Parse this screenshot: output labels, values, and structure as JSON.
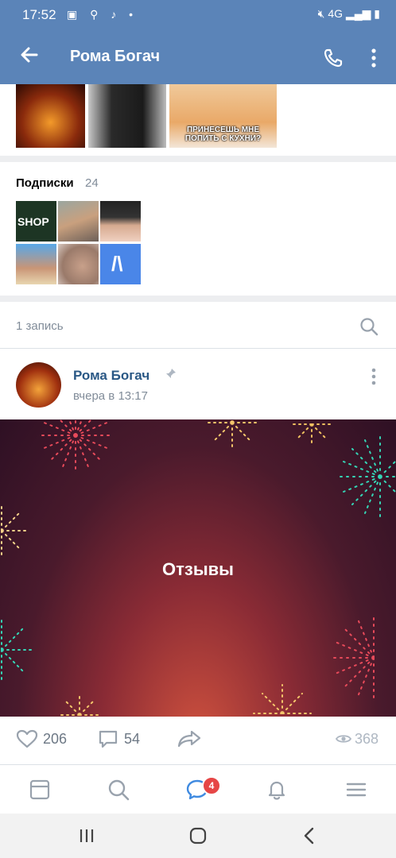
{
  "status_bar": {
    "time": "17:52",
    "network": "4G"
  },
  "header": {
    "title": "Рома Богач"
  },
  "photos": {
    "meme_caption": "ПРИНЕСЕШЬ МНЕ ПОПИТЬ С КУХНИ?"
  },
  "subscriptions": {
    "label": "Подписки",
    "count": "24",
    "items": [
      {
        "name": "shop-thumb",
        "text": "SHOP"
      },
      {
        "name": "photo-thumb-2"
      },
      {
        "name": "photo-thumb-3"
      },
      {
        "name": "photo-thumb-4"
      },
      {
        "name": "photo-thumb-5"
      },
      {
        "name": "logo-thumb",
        "text": "/\\"
      }
    ]
  },
  "records": {
    "label": "1 запись"
  },
  "post": {
    "author": "Рома Богач",
    "date": "вчера в 13:17",
    "image_title": "Отзывы",
    "likes": "206",
    "comments": "54",
    "views": "368"
  },
  "bottom_nav": {
    "messages_badge": "4"
  },
  "colors": {
    "header_bg": "#5b84b8",
    "link": "#2a5885",
    "muted": "#818c99",
    "badge": "#e64646",
    "accent": "#4a86e8"
  }
}
